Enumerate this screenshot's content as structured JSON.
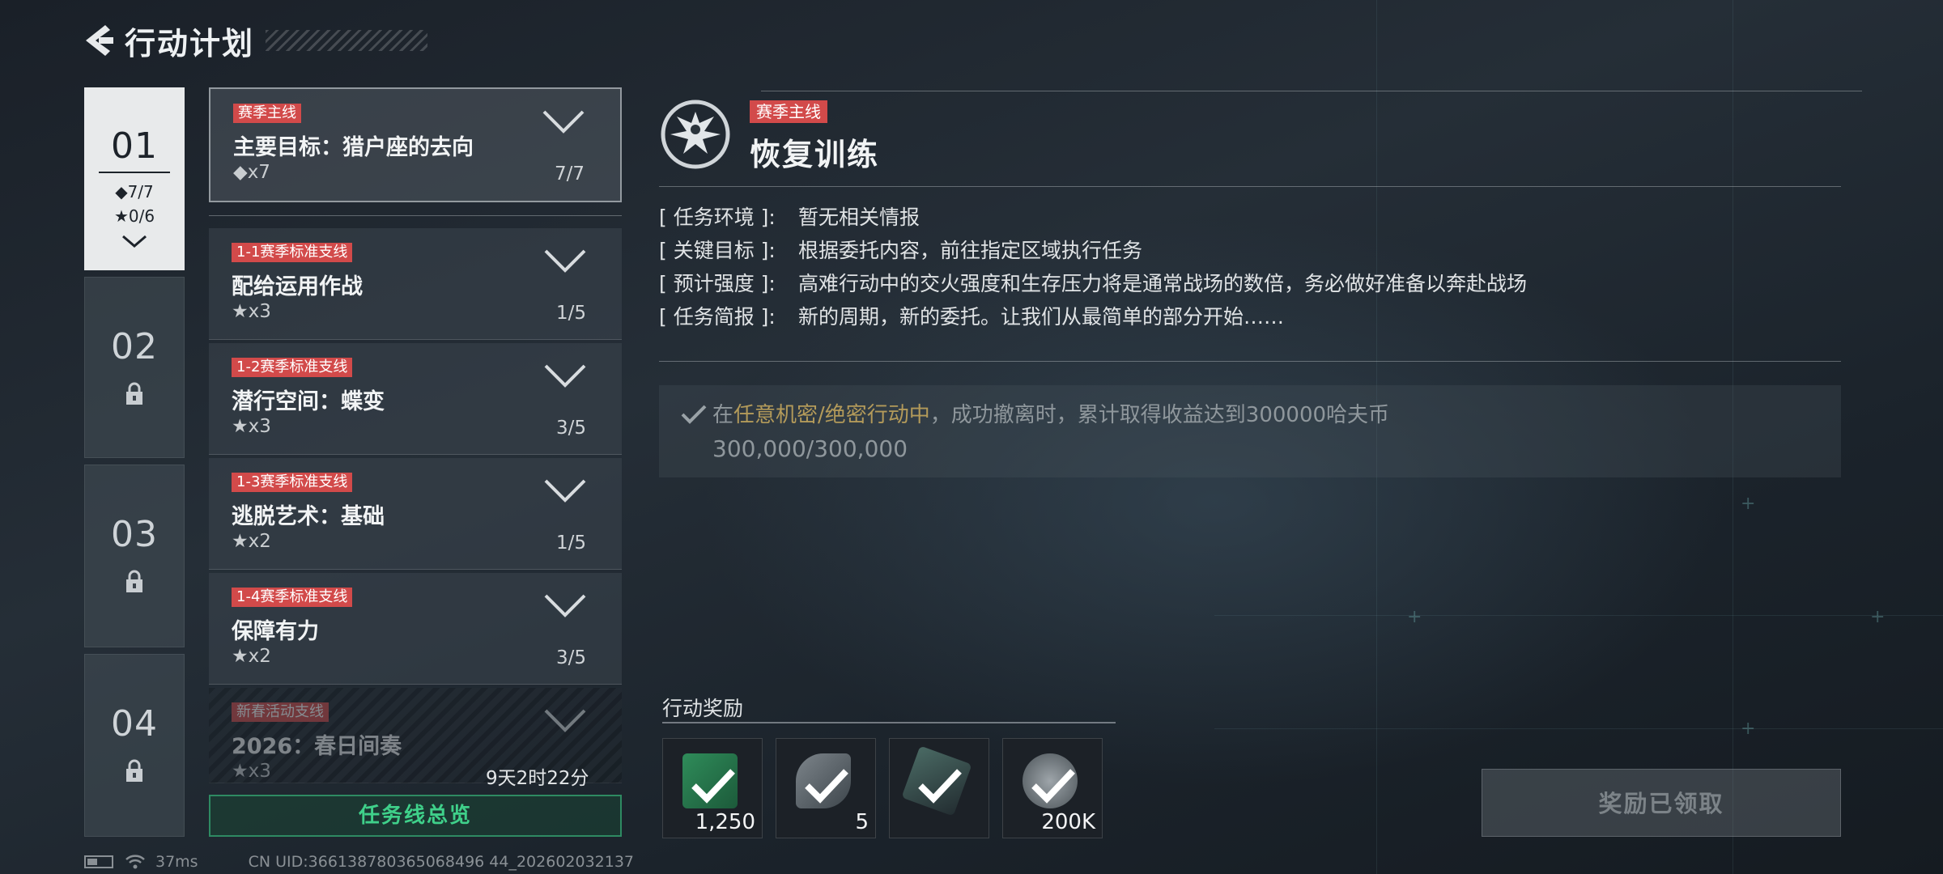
{
  "header": {
    "title": "行动计划"
  },
  "chapters": [
    {
      "num": "01",
      "stat_main": "◆7/7",
      "stat_star": "★0/6",
      "locked": false
    },
    {
      "num": "02",
      "locked": true
    },
    {
      "num": "03",
      "locked": true
    },
    {
      "num": "04",
      "locked": true
    }
  ],
  "missions": [
    {
      "tag": "赛季主线",
      "name": "主要目标：猎户座的去向",
      "reward": "◆x7",
      "progress": "7/7"
    },
    {
      "tag": "1-1赛季标准支线",
      "name": "配给运用作战",
      "reward": "★x3",
      "progress": "1/5"
    },
    {
      "tag": "1-2赛季标准支线",
      "name": "潜行空间：蝶变",
      "reward": "★x3",
      "progress": "3/5"
    },
    {
      "tag": "1-3赛季标准支线",
      "name": "逃脱艺术：基础",
      "reward": "★x2",
      "progress": "1/5"
    },
    {
      "tag": "1-4赛季标准支线",
      "name": "保障有力",
      "reward": "★x2",
      "progress": "3/5"
    },
    {
      "tag": "新春活动支线",
      "name": "2026：春日间奏",
      "reward": "★x3",
      "progress": "9天2时22分"
    }
  ],
  "overview_button": "任务线总览",
  "detail": {
    "tag": "赛季主线",
    "title": "恢复训练",
    "info": [
      {
        "label": "[ 任务环境 ]:",
        "value": "暂无相关情报"
      },
      {
        "label": "[ 关键目标 ]:",
        "value": "根据委托内容，前往指定区域执行任务"
      },
      {
        "label": "[ 预计强度 ]:",
        "value": "高难行动中的交火强度和生存压力将是通常战场的数倍，务必做好准备以奔赴战场"
      },
      {
        "label": "[ 任务简报 ]:",
        "value": "新的周期，新的委托。让我们从最简单的部分开始……"
      }
    ],
    "objective": {
      "prefix": "在",
      "highlight": "任意机密/绝密行动中",
      "suffix": "，成功撤离时，累计取得收益达到300000哈夫币",
      "progress": "300,000/300,000"
    }
  },
  "rewards": {
    "label": "行动奖励",
    "items": [
      {
        "icon": "green-case-icon",
        "qty": "1,250"
      },
      {
        "icon": "gear-part-icon",
        "qty": "5"
      },
      {
        "icon": "ammo-box-icon",
        "qty": ""
      },
      {
        "icon": "coin-icon",
        "qty": "200K"
      }
    ]
  },
  "claim_button": "奖励已领取",
  "status": {
    "ping": "37ms",
    "uid": "CN UID:366138780365068496 44_202602032137"
  },
  "colors": {
    "tag_red": "#d24a4a",
    "accent_green": "#3fd08a",
    "highlight_gold": "#b39a5a"
  }
}
